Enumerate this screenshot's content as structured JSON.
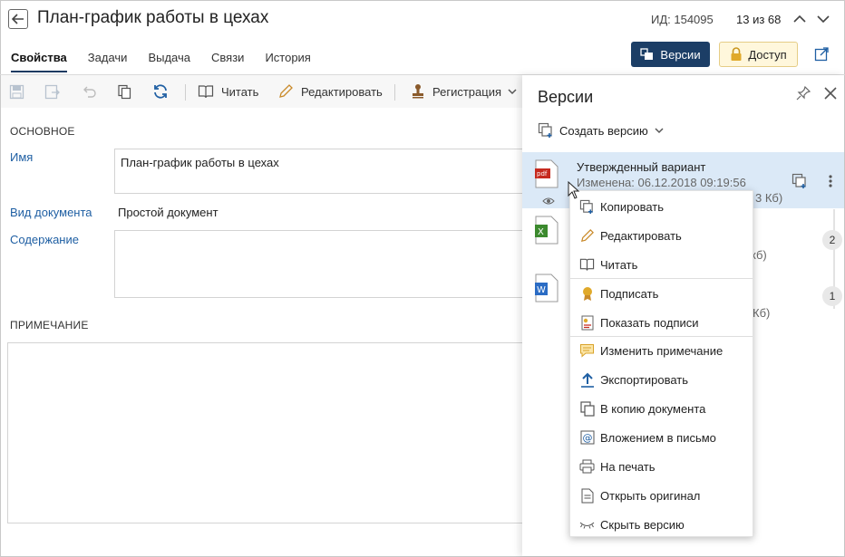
{
  "header": {
    "title": "План-график работы в цехах",
    "id_label": "ИД: 154095",
    "position": "13 из 68"
  },
  "tabs": [
    {
      "label": "Свойства"
    },
    {
      "label": "Задачи"
    },
    {
      "label": "Выдача"
    },
    {
      "label": "Связи"
    },
    {
      "label": "История"
    }
  ],
  "actions": {
    "versions_label": "Версии",
    "access_label": "Доступ"
  },
  "toolbar": {
    "read_label": "Читать",
    "edit_label": "Редактировать",
    "register_label": "Регистрация"
  },
  "form": {
    "section_main": "ОСНОВНОЕ",
    "name_label": "Имя",
    "name_value": "План-график работы в цехах",
    "doctype_label": "Вид документа",
    "doctype_value": "Простой документ",
    "content_label": "Содержание",
    "content_value": "",
    "section_note": "ПРИМЕЧАНИЕ",
    "note_value": ""
  },
  "panel": {
    "title": "Версии",
    "create_label": "Создать версию",
    "versions": [
      {
        "name": "Утвержденный вариант",
        "date": "Изменена: 06.12.2018 09:19:56",
        "size_partial": "3 Кб)",
        "type": "pdf"
      },
      {
        "size_partial": "кб)",
        "type": "xls",
        "badge": "2"
      },
      {
        "size_partial": "Кб)",
        "type": "doc",
        "badge": "1"
      }
    ]
  },
  "menu": {
    "items": [
      {
        "label": "Копировать",
        "icon": "copy-plus-icon"
      },
      {
        "label": "Редактировать",
        "icon": "pencil-icon"
      },
      {
        "label": "Читать",
        "icon": "book-icon"
      },
      {
        "label": "Подписать",
        "icon": "seal-icon"
      },
      {
        "label": "Показать подписи",
        "icon": "signatures-icon"
      },
      {
        "label": "Изменить примечание",
        "icon": "comment-icon"
      },
      {
        "label": "Экспортировать",
        "icon": "export-icon"
      },
      {
        "label": "В копию документа",
        "icon": "copy-doc-icon"
      },
      {
        "label": "Вложением в письмо",
        "icon": "email-attach-icon"
      },
      {
        "label": "На печать",
        "icon": "printer-icon"
      },
      {
        "label": "Открыть оригинал",
        "icon": "document-icon"
      },
      {
        "label": "Скрыть версию",
        "icon": "hide-eye-icon"
      }
    ]
  },
  "colors": {
    "accent": "#1c3e66",
    "link": "#1f5fa3",
    "selected_row": "#dbe9f7",
    "access_bg": "#fff7dc"
  }
}
